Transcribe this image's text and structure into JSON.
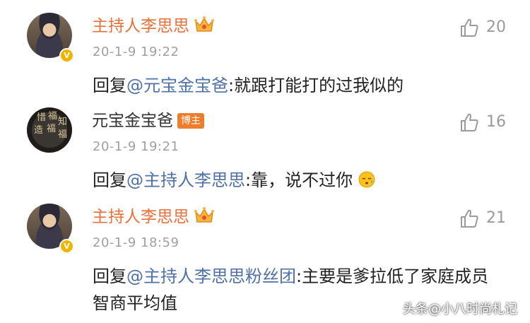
{
  "comments": [
    {
      "username": "主持人李思思",
      "time": "20-1-9 19:22",
      "likes": "20",
      "reply_prefix": "回复",
      "mention": "@元宝金宝爸",
      "text": ":就跟打能打的过我似的"
    },
    {
      "username": "元宝金宝爸",
      "badge": "博主",
      "time": "20-1-9 19:21",
      "likes": "16",
      "reply_prefix": "回复",
      "mention": "@主持人李思思",
      "text": ":靠，说不过你"
    },
    {
      "username": "主持人李思思",
      "time": "20-1-9 18:59",
      "likes": "21",
      "reply_prefix": "回复",
      "mention": "@主持人李思思粉丝团",
      "text": ":主要是爹拉低了家庭成员智商平均值"
    }
  ],
  "verified_mark": "V",
  "watermark": "头条@小八时尚札记",
  "colors": {
    "username_vip": "#e8703a",
    "mention": "#4e71a8",
    "time": "#a0a0a0",
    "badge": "#ee7d2c"
  },
  "icons": [
    "crown-icon",
    "thumbs-up-icon",
    "sleepy-emoji-icon",
    "verified-badge-icon"
  ]
}
